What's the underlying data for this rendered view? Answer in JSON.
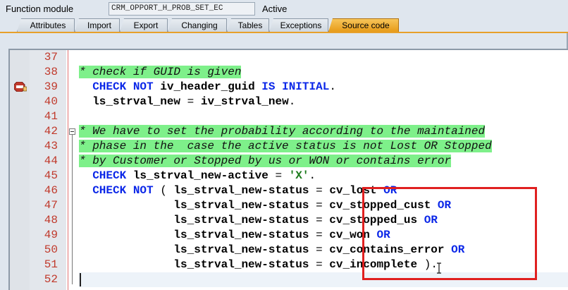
{
  "header": {
    "label": "Function module",
    "name": "CRM_OPPORT_H_PROB_SET_EC",
    "status": "Active"
  },
  "tabs": [
    {
      "label": "Attributes"
    },
    {
      "label": "Import"
    },
    {
      "label": "Export"
    },
    {
      "label": "Changing"
    },
    {
      "label": "Tables"
    },
    {
      "label": "Exceptions"
    },
    {
      "label": "Source code"
    }
  ],
  "editor": {
    "lines": [
      {
        "num": "37",
        "text": ""
      },
      {
        "num": "38",
        "text": "* check if GUID is given"
      },
      {
        "num": "39",
        "text": "  CHECK NOT iv_header_guid IS INITIAL."
      },
      {
        "num": "40",
        "text": "  ls_strval_new = iv_strval_new."
      },
      {
        "num": "41",
        "text": ""
      },
      {
        "num": "42",
        "text": "* We have to set the probability according to the maintained"
      },
      {
        "num": "43",
        "text": "* phase in the  case the active status is not Lost OR Stopped"
      },
      {
        "num": "44",
        "text": "* by Customer or Stopped by us or WON or contains error"
      },
      {
        "num": "45",
        "text": "  CHECK ls_strval_new-active = 'X'."
      },
      {
        "num": "46",
        "text": "  CHECK NOT ( ls_strval_new-status = cv_lost OR"
      },
      {
        "num": "47",
        "text": "              ls_strval_new-status = cv_stopped_cust OR"
      },
      {
        "num": "48",
        "text": "              ls_strval_new-status = cv_stopped_us OR"
      },
      {
        "num": "49",
        "text": "              ls_strval_new-status = cv_won OR"
      },
      {
        "num": "50",
        "text": "              ls_strval_new-status = cv_contains_error OR"
      },
      {
        "num": "51",
        "text": "              ls_strval_new-status = cv_incomplete )."
      },
      {
        "num": "52",
        "text": ""
      }
    ]
  },
  "colors": {
    "comment_bg": "#7ef08a",
    "keyword": "#0b27e8",
    "line_number": "#c0392b",
    "active_tab": "#e79b18",
    "highlight_box": "#e02020"
  },
  "icons": {
    "breakpoint": "stop-breakpoint-icon",
    "fold": "collapse-block-icon"
  }
}
